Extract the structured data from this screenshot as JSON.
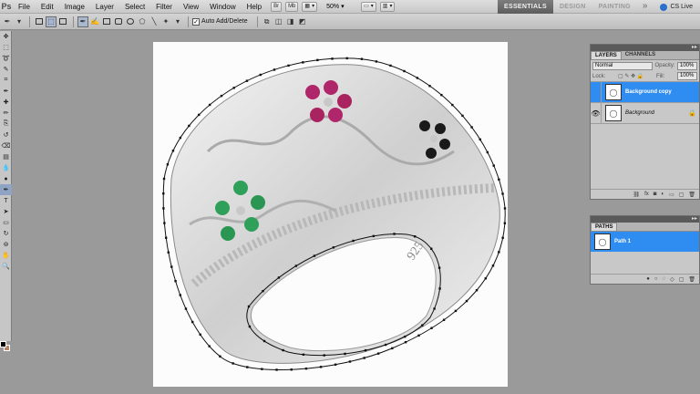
{
  "app": {
    "logo": "Ps"
  },
  "menu": {
    "items": [
      "File",
      "Edit",
      "Image",
      "Layer",
      "Select",
      "Filter",
      "View",
      "Window",
      "Help"
    ]
  },
  "appbar": {
    "zoom": "50%",
    "mini_bridge": "Br",
    "mini": "Mb"
  },
  "workspace": {
    "tabs": [
      "ESSENTIALS",
      "DESIGN",
      "PAINTING"
    ],
    "active": "ESSENTIALS",
    "more": "»",
    "cs_live": "CS Live"
  },
  "options": {
    "auto_add_delete_label": "Auto Add/Delete",
    "auto_add_delete_checked": true
  },
  "tools": {
    "icons": [
      "move-icon",
      "marquee-icon",
      "lasso-icon",
      "quick-select-icon",
      "crop-icon",
      "eyedropper-icon",
      "healing-icon",
      "brush-icon",
      "clone-stamp-icon",
      "history-brush-icon",
      "eraser-icon",
      "gradient-icon",
      "blur-icon",
      "dodge-icon",
      "pen-icon",
      "type-icon",
      "path-select-icon",
      "shape-icon",
      "3d-rotate-icon",
      "3d-orbit-icon",
      "hand-icon",
      "zoom-icon"
    ],
    "glyphs": [
      "✥",
      "⬚",
      "➰",
      "✎",
      "⌗",
      "✒",
      "✚",
      "✏",
      "⎘",
      "↺",
      "⌫",
      "▤",
      "💧",
      "●",
      "✒",
      "T",
      "➤",
      "▭",
      "↻",
      "⊚",
      "✋",
      "🔍"
    ],
    "active_index": 14,
    "foreground_color": "#000000",
    "background_color": "#b5856b"
  },
  "layers_panel": {
    "tabs": [
      "LAYERS",
      "CHANNELS"
    ],
    "active_tab": "LAYERS",
    "blend_mode": "Normal",
    "opacity_label": "Opacity:",
    "opacity": "100%",
    "lock_label": "Lock:",
    "fill_label": "Fill:",
    "fill": "100%",
    "layers": [
      {
        "name": "Background copy",
        "selected": true,
        "visible": false,
        "locked": false
      },
      {
        "name": "Background",
        "selected": false,
        "visible": true,
        "locked": true
      }
    ],
    "footer_icons": [
      "link-icon",
      "fx-icon",
      "mask-icon",
      "adjustment-icon",
      "group-icon",
      "new-layer-icon",
      "trash-icon"
    ]
  },
  "paths_panel": {
    "tabs": [
      "PATHS"
    ],
    "paths": [
      {
        "name": "Path 1",
        "selected": true
      }
    ],
    "footer_icons": [
      "fill-path-icon",
      "stroke-path-icon",
      "load-selection-icon",
      "make-path-icon",
      "new-path-icon",
      "trash-icon"
    ]
  },
  "colors": {
    "selection_blue": "#2f8cf0",
    "ruby": "#b0266a",
    "emerald": "#2fa05a",
    "onyx": "#1a1a1a"
  }
}
